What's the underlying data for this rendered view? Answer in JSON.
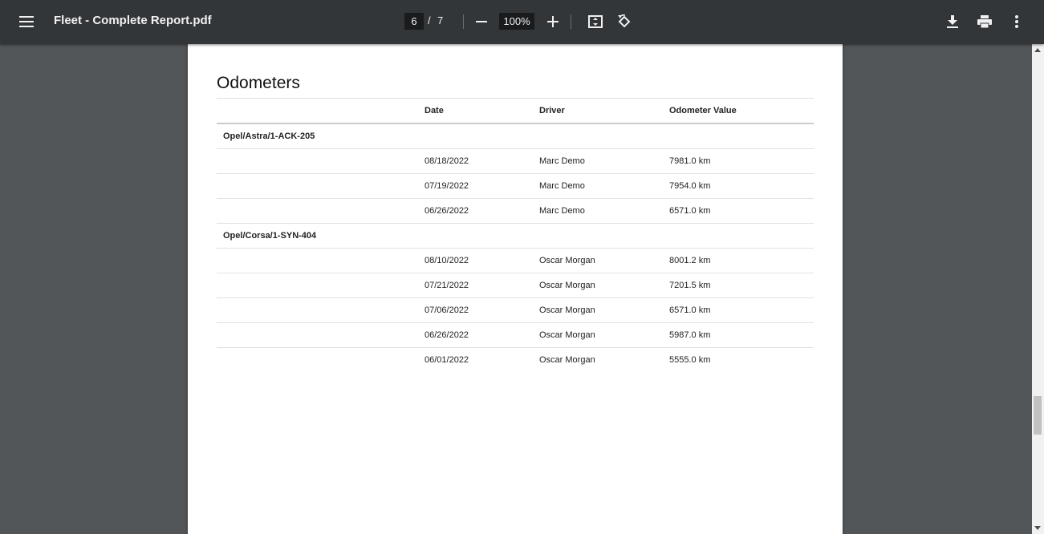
{
  "toolbar": {
    "title": "Fleet - Complete Report.pdf",
    "current_page": "6",
    "page_separator": "/",
    "total_pages": "7",
    "zoom": "100%",
    "icons": {
      "menu": "menu-icon",
      "zoom_out": "zoom-out-icon",
      "zoom_in": "zoom-in-icon",
      "fit": "fit-to-page-icon",
      "rotate": "rotate-icon",
      "download": "download-icon",
      "print": "print-icon",
      "more": "more-vert-icon"
    }
  },
  "report": {
    "title": "Odometers",
    "columns": [
      "",
      "Date",
      "Driver",
      "Odometer Value"
    ],
    "groups": [
      {
        "vehicle": "Opel/Astra/1-ACK-205",
        "rows": [
          {
            "date": "08/18/2022",
            "driver": "Marc Demo",
            "value": "7981.0 km"
          },
          {
            "date": "07/19/2022",
            "driver": "Marc Demo",
            "value": "7954.0 km"
          },
          {
            "date": "06/26/2022",
            "driver": "Marc Demo",
            "value": "6571.0 km"
          }
        ]
      },
      {
        "vehicle": "Opel/Corsa/1-SYN-404",
        "rows": [
          {
            "date": "08/10/2022",
            "driver": "Oscar Morgan",
            "value": "8001.2 km"
          },
          {
            "date": "07/21/2022",
            "driver": "Oscar Morgan",
            "value": "7201.5 km"
          },
          {
            "date": "07/06/2022",
            "driver": "Oscar Morgan",
            "value": "6571.0 km"
          },
          {
            "date": "06/26/2022",
            "driver": "Oscar Morgan",
            "value": "5987.0 km"
          },
          {
            "date": "06/01/2022",
            "driver": "Oscar Morgan",
            "value": "5555.0 km"
          }
        ]
      }
    ]
  }
}
